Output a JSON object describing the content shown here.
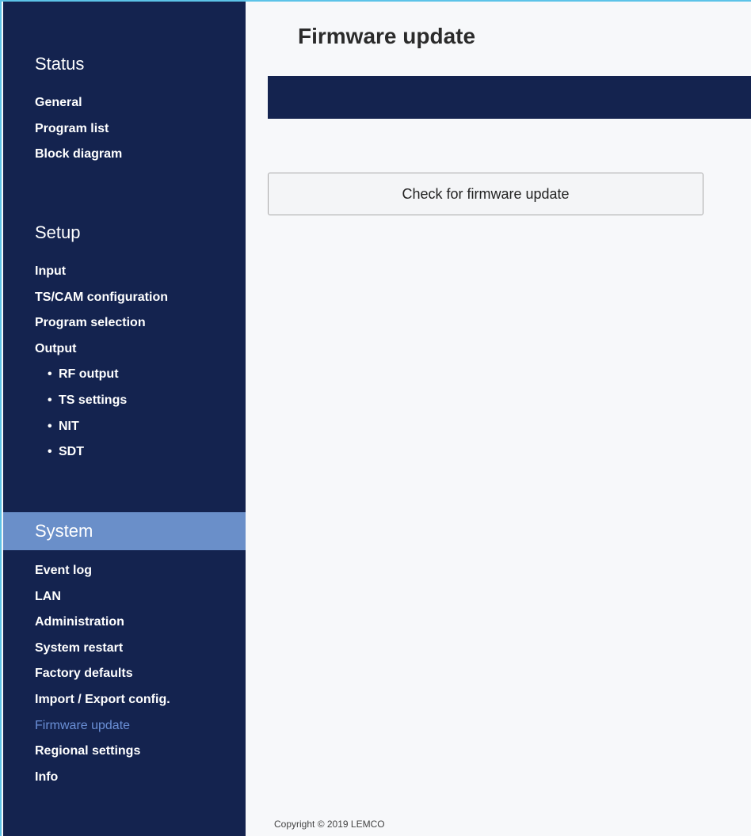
{
  "sidebar": {
    "status": {
      "title": "Status",
      "items": [
        "General",
        "Program list",
        "Block diagram"
      ]
    },
    "setup": {
      "title": "Setup",
      "items": [
        "Input",
        "TS/CAM configuration",
        "Program selection",
        "Output"
      ],
      "subitems": [
        "RF output",
        "TS settings",
        "NIT",
        "SDT"
      ],
      "bullet": "•"
    },
    "system": {
      "title": "System",
      "items": [
        "Event log",
        "LAN",
        "Administration",
        "System restart",
        "Factory defaults",
        "Import / Export config.",
        "Firmware update",
        "Regional settings",
        "Info"
      ],
      "selected_index": 6
    }
  },
  "main": {
    "title": "Firmware update",
    "check_button_label": "Check for firmware update"
  },
  "footer": {
    "copyright": "Copyright © 2019 LEMCO"
  },
  "colors": {
    "sidebar_bg": "#14234f",
    "active_section_bg": "#6a8fc9",
    "selected_item": "#6a8fd6",
    "frame_border": "#5cc3e8"
  }
}
